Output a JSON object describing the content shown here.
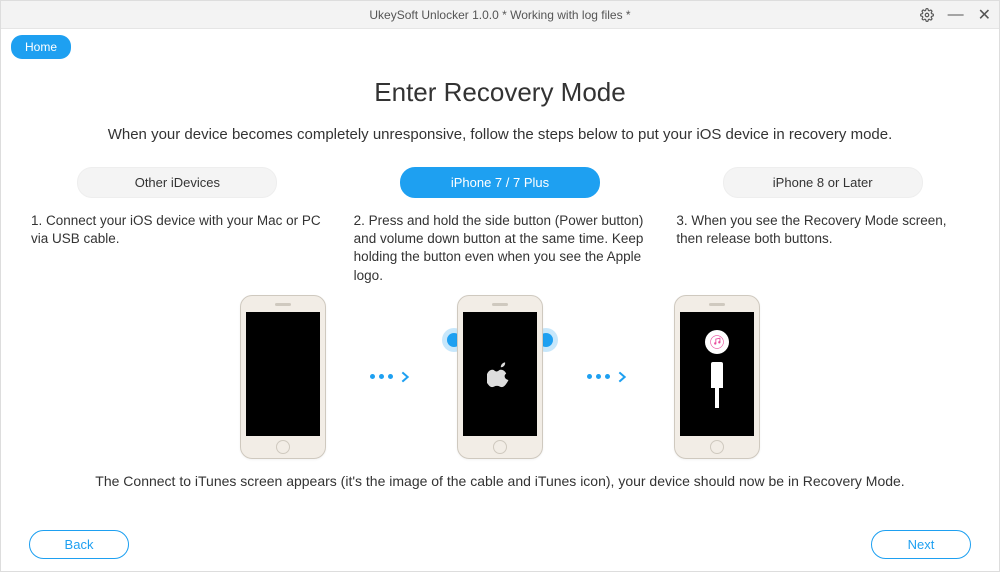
{
  "window": {
    "title": "UkeySoft Unlocker 1.0.0 * Working with log files *",
    "controls": {
      "settings_icon": "settings",
      "minimize": "—",
      "close": "✕"
    }
  },
  "home_button": "Home",
  "page": {
    "title": "Enter Recovery Mode",
    "subtitle": "When your device becomes completely unresponsive, follow the steps below to put your iOS device in recovery mode."
  },
  "tabs": [
    {
      "label": "Other iDevices",
      "active": false
    },
    {
      "label": "iPhone 7 / 7 Plus",
      "active": true
    },
    {
      "label": "iPhone 8 or Later",
      "active": false
    }
  ],
  "steps": [
    "1. Connect your iOS device with your Mac or PC via USB cable.",
    "2. Press and hold the side button (Power button) and volume down button at the same time. Keep holding the button even when you see the Apple logo.",
    "3. When you see the Recovery Mode screen, then release both buttons."
  ],
  "footer_note": "The Connect to iTunes screen appears (it's the image of the cable and iTunes icon), your device should now be in Recovery Mode.",
  "nav": {
    "back": "Back",
    "next": "Next"
  },
  "colors": {
    "accent": "#1ea0f1"
  }
}
